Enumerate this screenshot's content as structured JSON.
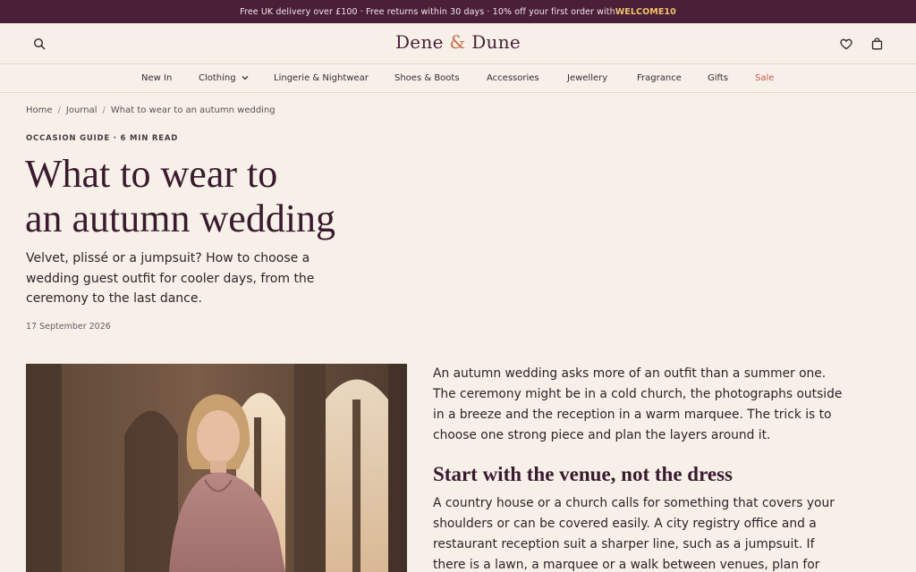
{
  "promo": {
    "text": "Free UK delivery over £100 · Free returns within 30 days · 10% off your first order with ",
    "code": "WELCOME10"
  },
  "header": {
    "logo_part1": "Dene ",
    "logo_amp": "&",
    "logo_part2": " Dune",
    "icons": [
      "search-icon",
      "heart-icon",
      "bag-icon"
    ]
  },
  "nav": {
    "items": [
      "New In",
      "Clothing",
      "Lingerie & Nightwear",
      "Shoes & Boots",
      "Accessories",
      "Jewellery",
      "Fragrance",
      "Gifts",
      "Sale"
    ]
  },
  "breadcrumb": {
    "items": [
      "Home",
      "Journal",
      "What to wear to an autumn wedding"
    ],
    "separator": "/"
  },
  "article": {
    "kicker": "OCCASION GUIDE · 6 MIN READ",
    "title_line1": "What to wear to",
    "title_line2": "an autumn wedding",
    "standfirst": "Velvet, plissé or a jumpsuit? How to choose a wedding guest outfit for cooler days, from the ceremony to the last dance.",
    "date": "17 September 2026",
    "para1": "An autumn wedding asks more of an outfit than a summer one. The ceremony might be in a cold church, the photographs outside in a breeze and the reception in a warm marquee. The trick is to choose one strong piece and plan the layers around it.",
    "heading": "Start with the venue, not the dress",
    "para2": "A country house or a church calls for something that covers your shoulders or can be covered easily. A city registry office and a restaurant reception suit a sharper line, such as a jumpsuit. If there is a lawn, a marquee or a walk between venues, plan for"
  },
  "colors": {
    "promo_bg": "#4a1f38",
    "page_bg": "#f6f0e8",
    "accent_code": "#f0c36a",
    "logo_amp": "#c9714d",
    "sale": "#c25a4e"
  }
}
